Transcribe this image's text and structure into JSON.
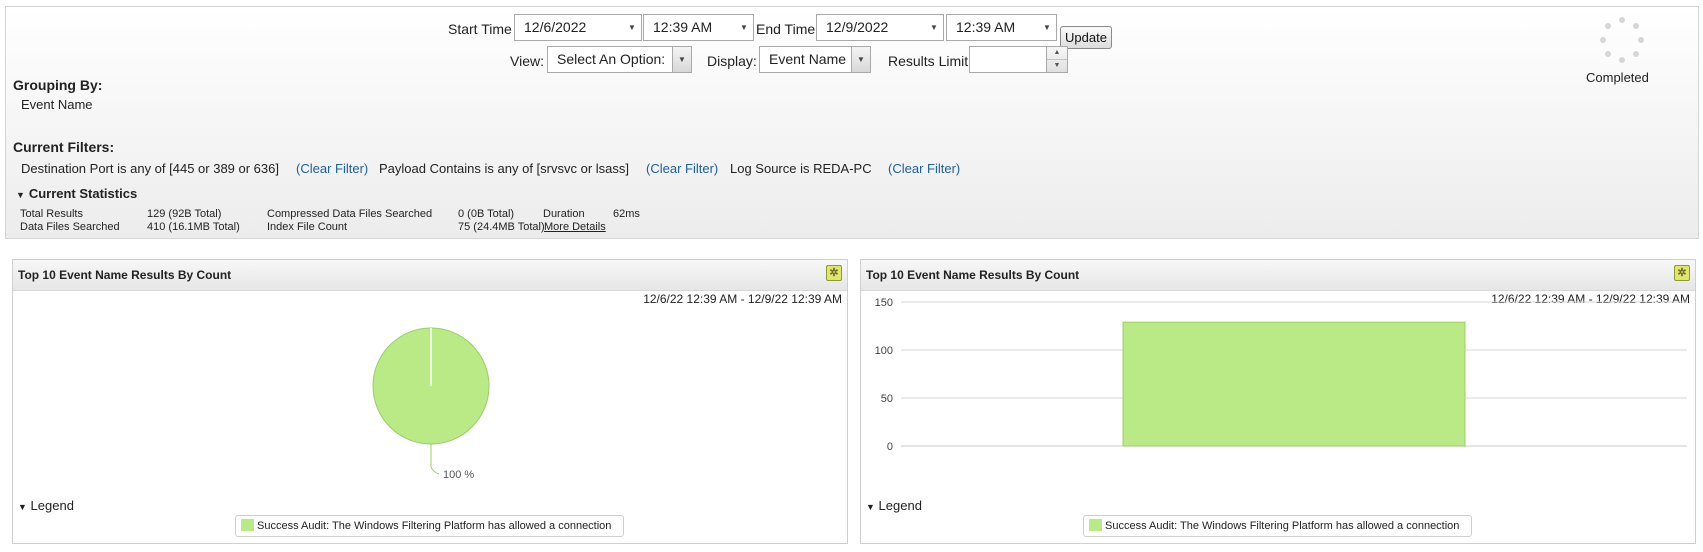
{
  "filters_bar": {
    "start_time_label": "Start Time",
    "start_date": "12/6/2022",
    "start_time": "12:39 AM",
    "end_time_label": "End Time",
    "end_date": "12/9/2022",
    "end_time": "12:39 AM",
    "update_label": "Update",
    "view_label": "View:",
    "view_value": "Select An Option:",
    "display_label": "Display:",
    "display_value": "Event Name",
    "results_limit_label": "Results Limit",
    "results_limit_value": ""
  },
  "status": {
    "text": "Completed"
  },
  "grouping": {
    "heading": "Grouping By:",
    "value": "Event Name"
  },
  "current_filters": {
    "heading": "Current Filters:",
    "items": [
      {
        "text": "Destination Port is any of [445 or 389 or 636]",
        "clear": "(Clear Filter)"
      },
      {
        "text": "Payload Contains is any of [srvsvc or lsass]",
        "clear": "(Clear Filter)"
      },
      {
        "text": "Log Source is REDA-PC",
        "clear": "(Clear Filter)"
      }
    ]
  },
  "statistics": {
    "heading": "Current Statistics",
    "total_results_label": "Total Results",
    "total_results_value": "129 (92B Total)",
    "data_files_label": "Data Files Searched",
    "data_files_value": "410 (16.1MB Total)",
    "compressed_label": "Compressed Data Files Searched",
    "compressed_value": "0 (0B Total)",
    "index_label": "Index File Count",
    "index_value": "75 (24.4MB Total)",
    "duration_label": "Duration",
    "duration_value": "62ms",
    "more_details": "More Details"
  },
  "pie_card": {
    "title": "Top 10 Event Name Results By Count",
    "daterange": "12/6/22 12:39 AM - 12/9/22 12:39 AM",
    "legend_label": "Legend",
    "legend_item": "Success Audit: The Windows Filtering Platform has allowed a connection"
  },
  "bar_card": {
    "title": "Top 10 Event Name Results By Count",
    "daterange": "12/6/22 12:39 AM - 12/9/22 12:39 AM",
    "legend_label": "Legend",
    "legend_item": "Success Audit: The Windows Filtering Platform has allowed a connection"
  },
  "colors": {
    "series": "#b9ea85",
    "series_stroke": "#9ccc6a",
    "link": "#1a5f9e"
  },
  "chart_data": [
    {
      "type": "pie",
      "slices": [
        {
          "label": "Success Audit: The Windows Filtering Platform has allowed a connection",
          "value": 100,
          "display": "100 %"
        }
      ]
    },
    {
      "type": "bar",
      "categories": [
        "Success Audit: The Windows Filtering Platform has allowed a connection"
      ],
      "values": [
        129
      ],
      "ylim": [
        0,
        150
      ],
      "yticks": [
        0,
        50,
        100,
        150
      ],
      "grid": true
    }
  ]
}
